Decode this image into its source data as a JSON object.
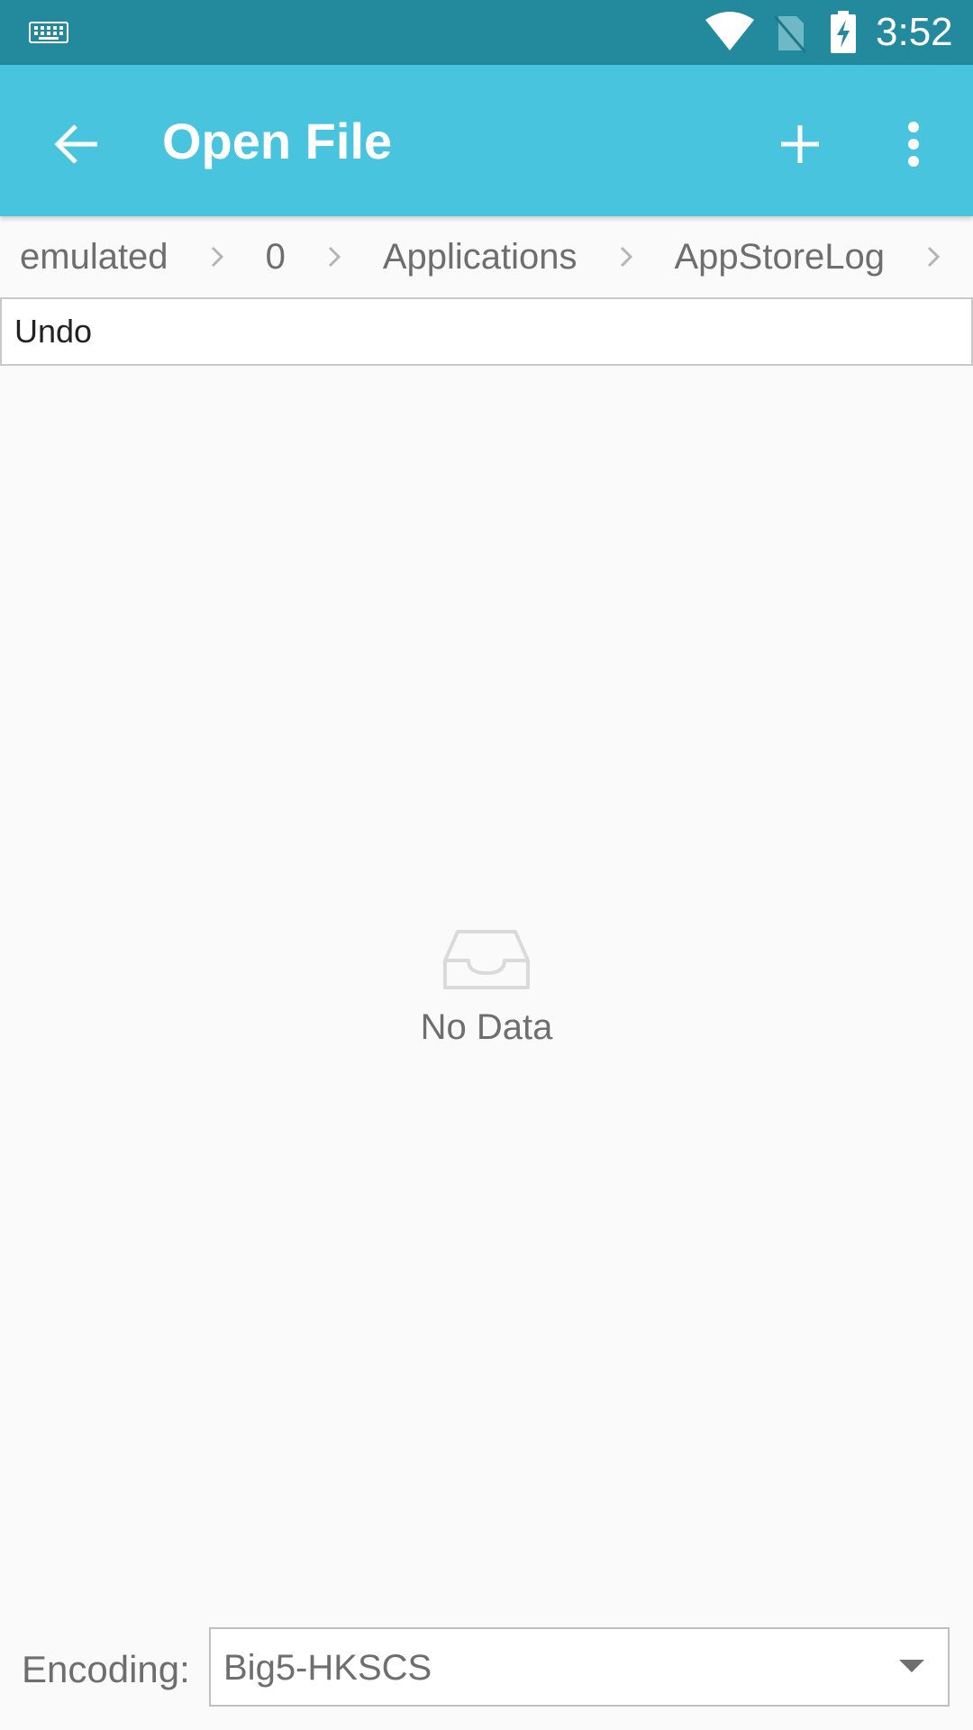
{
  "status_bar": {
    "time": "3:52",
    "icons": [
      "keyboard-icon",
      "wifi-icon",
      "no-sim-icon",
      "battery-charging-icon"
    ]
  },
  "app_bar": {
    "title": "Open File",
    "background": "#48c4df",
    "icons": [
      "back-arrow-icon",
      "plus-icon",
      "more-vert-icon"
    ]
  },
  "breadcrumb": {
    "items": [
      "emulated",
      "0",
      "Applications",
      "AppStoreLog"
    ]
  },
  "input": {
    "value": "Undo"
  },
  "empty_state": {
    "icon": "inbox-icon",
    "text": "No Data"
  },
  "footer": {
    "encoding_label": "Encoding:",
    "encoding_value": "Big5-HKSCS"
  }
}
